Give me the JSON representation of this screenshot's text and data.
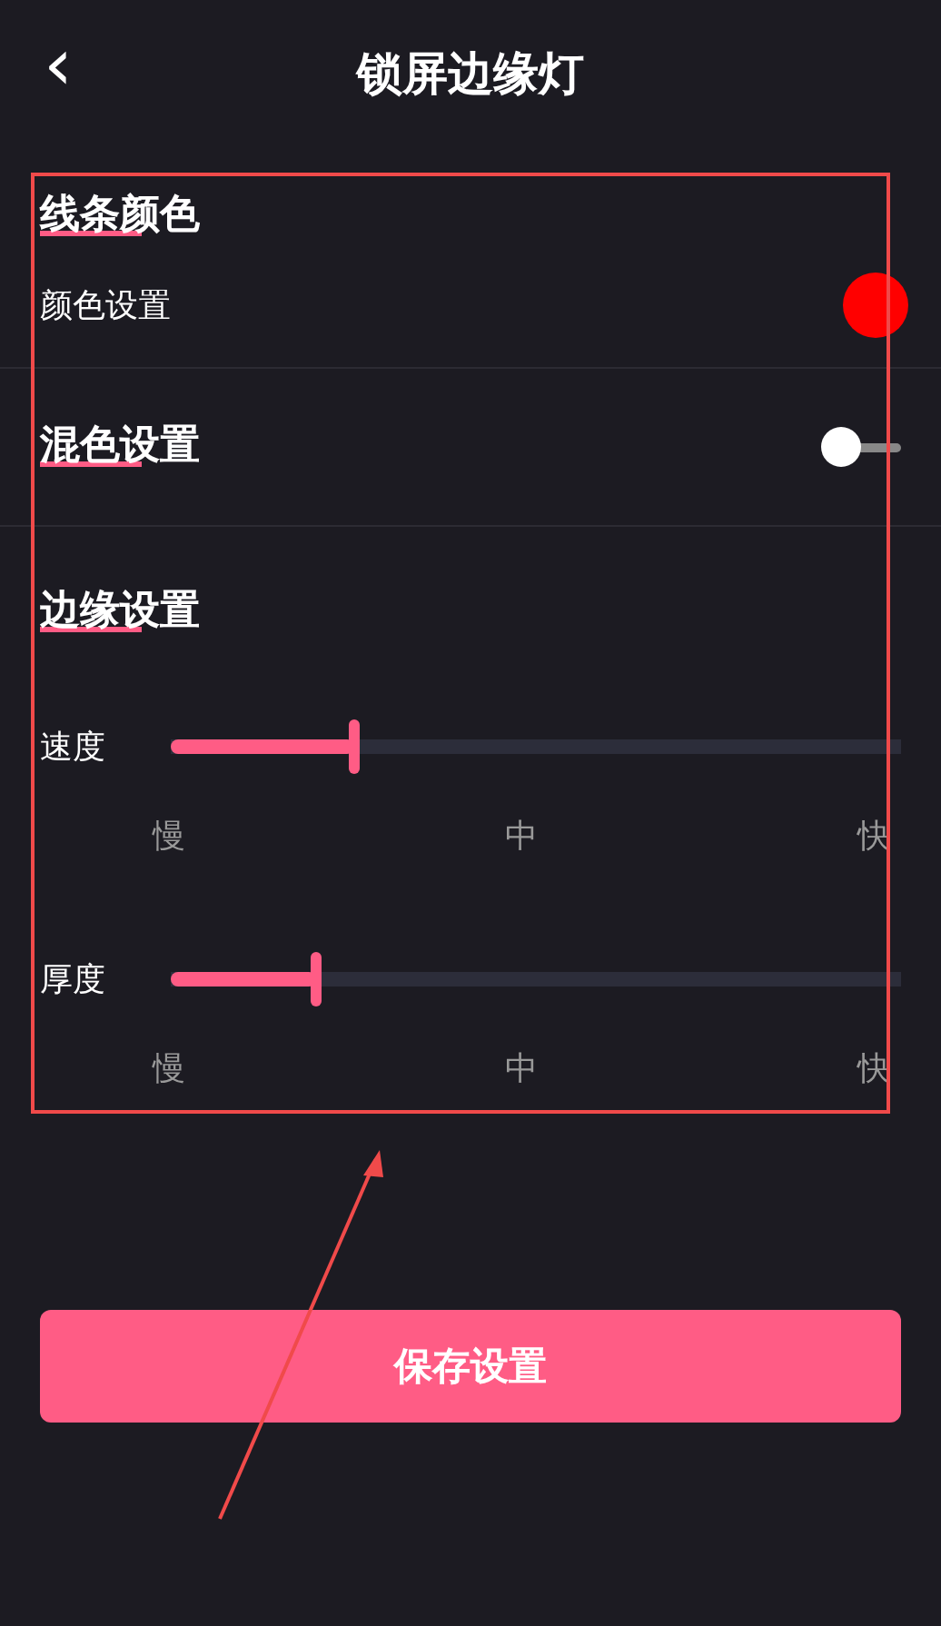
{
  "header": {
    "back": "‹",
    "title": "锁屏边缘灯"
  },
  "line_color": {
    "heading": "线条颜色",
    "row_label": "颜色设置",
    "color": "#ff0000"
  },
  "blend": {
    "heading": "混色设置",
    "on": false
  },
  "edge": {
    "heading": "边缘设置",
    "sliders": [
      {
        "label": "速度",
        "level": 0.25,
        "ticks": [
          "慢",
          "中",
          "快"
        ]
      },
      {
        "label": "厚度",
        "level": 0.2,
        "ticks": [
          "慢",
          "中",
          "快"
        ]
      }
    ]
  },
  "save_button": "保存设置"
}
